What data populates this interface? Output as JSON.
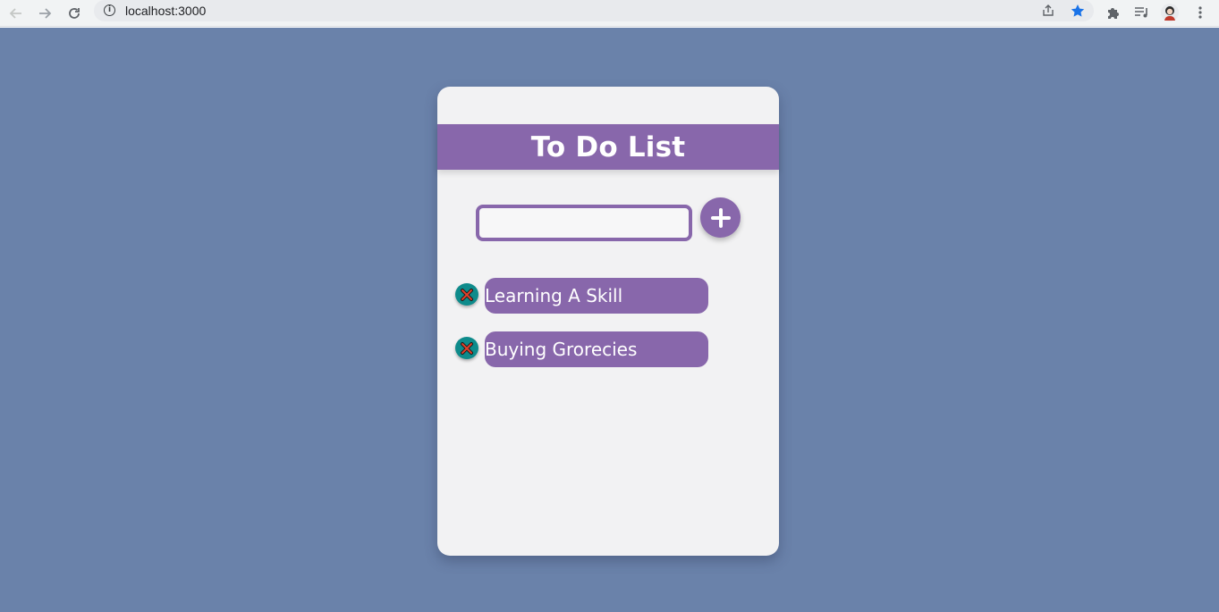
{
  "browser": {
    "url": "localhost:3000",
    "icons": {
      "back": "arrow-left-icon",
      "forward": "arrow-right-icon",
      "reload": "reload-icon",
      "info": "info-icon",
      "share": "share-icon",
      "bookmark": "star-icon",
      "extensions": "puzzle-icon",
      "media": "playlist-icon",
      "profile": "avatar",
      "menu": "kebab-menu-icon"
    }
  },
  "app": {
    "title": "To Do List",
    "input": {
      "value": "",
      "placeholder": ""
    },
    "add_button_label": "+",
    "items": [
      {
        "text": "Learning A Skill"
      },
      {
        "text": "Buying Grorecies"
      }
    ]
  },
  "colors": {
    "page_background": "#6a82aa",
    "card_background": "#f2f2f3",
    "accent_purple": "#8867ab",
    "delete_teal": "#0e8b8b",
    "delete_x_red": "#e0402b"
  }
}
